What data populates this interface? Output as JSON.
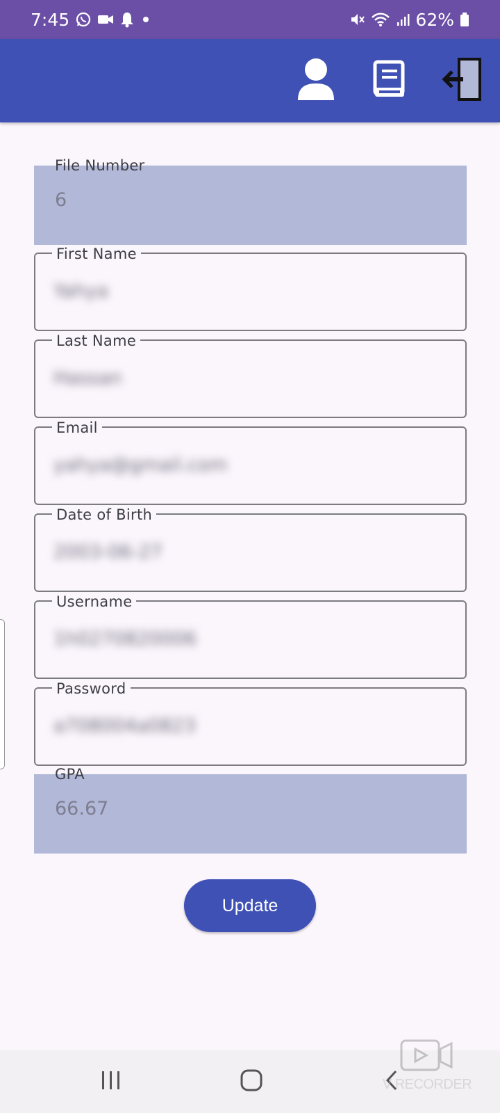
{
  "status_bar": {
    "time": "7:45",
    "battery": "62%",
    "icons": [
      "whatsapp-icon",
      "video-icon",
      "notification-bell-icon",
      "dot-icon",
      "mute-icon",
      "wifi-icon",
      "signal-icon",
      "battery-icon"
    ]
  },
  "app_bar": {
    "background": "#3f51b5",
    "actions": [
      "person-icon",
      "book-icon",
      "logout-icon"
    ]
  },
  "form": {
    "fields": [
      {
        "label": "File Number",
        "value": "6",
        "style": "filled"
      },
      {
        "label": "First Name",
        "value": "Yahya",
        "style": "outlined"
      },
      {
        "label": "Last Name",
        "value": "Hassan",
        "style": "outlined"
      },
      {
        "label": "Email",
        "value": "yahya@gmail.com",
        "style": "outlined"
      },
      {
        "label": "Date of Birth",
        "value": "2003-06-27",
        "style": "outlined"
      },
      {
        "label": "Username",
        "value": "1h0270820006",
        "style": "outlined"
      },
      {
        "label": "Password",
        "value": "a708004a0823",
        "style": "outlined"
      },
      {
        "label": "GPA",
        "value": "66.67",
        "style": "filled"
      }
    ],
    "submit_label": "Update"
  },
  "nav_bar": {
    "buttons": [
      "recents-icon",
      "home-icon",
      "back-icon"
    ]
  },
  "watermark": {
    "text": "V RECORDER"
  },
  "colors": {
    "status_bar": "#6b4fa6",
    "primary": "#3f51b5",
    "filled_field": "#b2b8d8",
    "background": "#fbf6fc"
  }
}
